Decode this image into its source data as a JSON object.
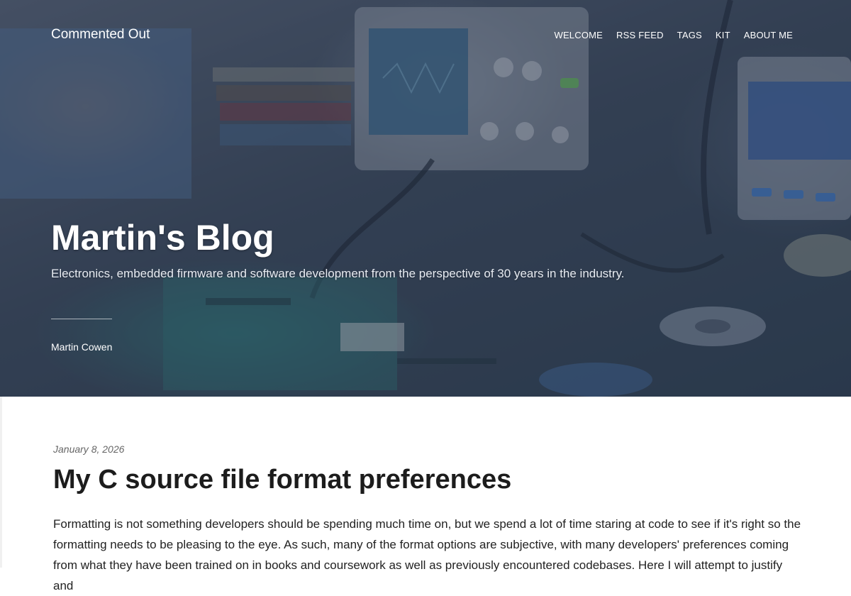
{
  "site": {
    "title": "Commented Out"
  },
  "nav": {
    "items": [
      {
        "label": "WELCOME"
      },
      {
        "label": "RSS FEED"
      },
      {
        "label": "TAGS"
      },
      {
        "label": "KIT"
      },
      {
        "label": "ABOUT ME"
      }
    ]
  },
  "hero": {
    "title": "Martin's Blog",
    "subtitle": "Electronics, embedded firmware and software development from the perspective of 30 years in the industry.",
    "author": "Martin Cowen"
  },
  "post": {
    "date": "January 8, 2026",
    "title": "My C source file format preferences",
    "excerpt": "Formatting is not something developers should be spending much time on, but we spend a lot of time staring at code to see if it's right so the formatting needs to be pleasing to the eye. As such, many of the format options are subjective, with many developers' preferences coming from what they have been trained on in books and coursework as well as previously encountered codebases. Here I will attempt to justify and"
  }
}
